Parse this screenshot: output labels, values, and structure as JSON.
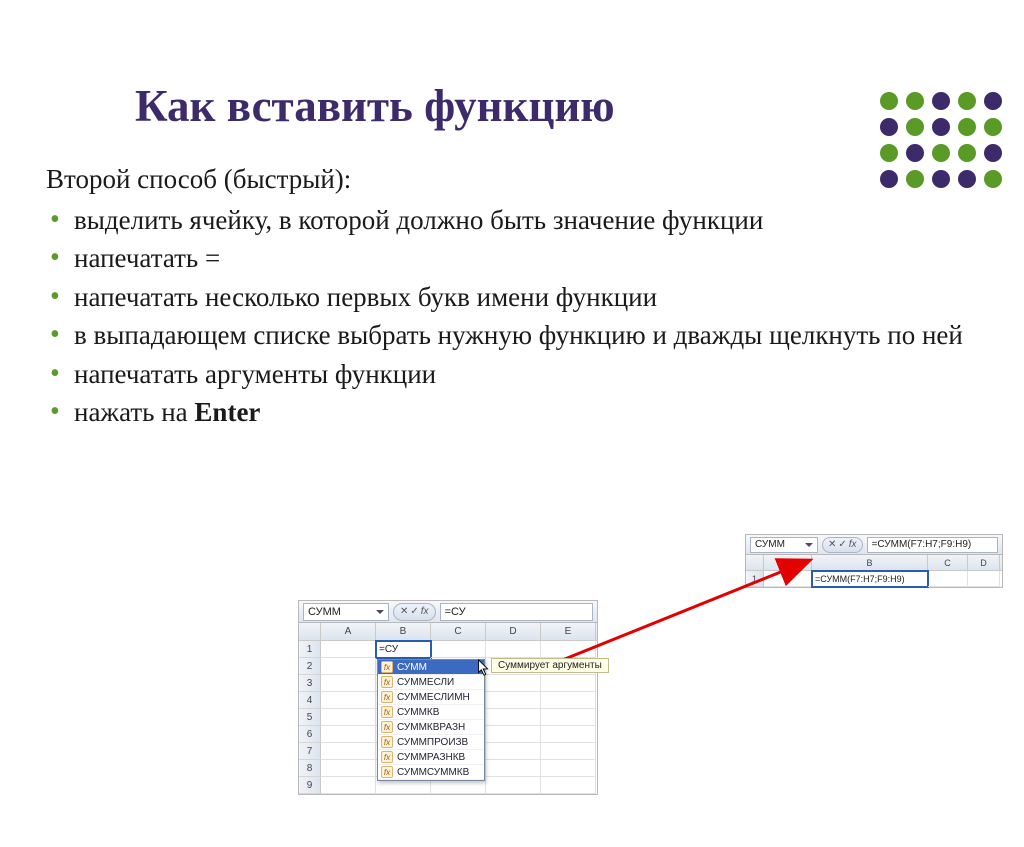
{
  "title": "Как вставить функцию",
  "lead": "Второй способ (быстрый):",
  "bullets": [
    "выделить ячейку, в которой должно быть значение функции",
    "напечатать =",
    "напечатать несколько первых букв имени функции",
    "в выпадающем списке выбрать нужную функцию и дважды щелкнуть по ней",
    "напечатать аргументы функции",
    "нажать на "
  ],
  "enter_label": "Enter",
  "excel1": {
    "namebox": "СУММ",
    "formula": "=СУ",
    "cols": [
      "A",
      "B",
      "C",
      "D",
      "E"
    ],
    "rows": [
      "1",
      "2",
      "3",
      "4",
      "5",
      "6",
      "7",
      "8",
      "9"
    ],
    "cell_b1": "=СУ",
    "tooltip": "Суммирует аргументы",
    "autocomplete": [
      "СУММ",
      "СУММЕСЛИ",
      "СУММЕСЛИМН",
      "СУММКВ",
      "СУММКВРАЗН",
      "СУММПРОИЗВ",
      "СУММРАЗНКВ",
      "СУММСУММКВ"
    ],
    "fx_buttons": {
      "x": "✕",
      "v": "✓",
      "fx": "fx"
    }
  },
  "excel2": {
    "namebox": "СУММ",
    "formula": "=СУММ(F7:H7;F9:H9)",
    "cols": [
      "A",
      "B",
      "C",
      "D"
    ],
    "rows": [
      "1"
    ],
    "cell_b1": "=СУММ(F7:H7;F9:H9)",
    "fx_buttons": {
      "x": "✕",
      "v": "✓",
      "fx": "fx"
    }
  },
  "dots_pattern": [
    "a",
    "a",
    "b",
    "a",
    "b",
    "b",
    "a",
    "b",
    "a",
    "a",
    "a",
    "b",
    "a",
    "a",
    "b",
    "b",
    "a",
    "b",
    "b",
    "a"
  ]
}
